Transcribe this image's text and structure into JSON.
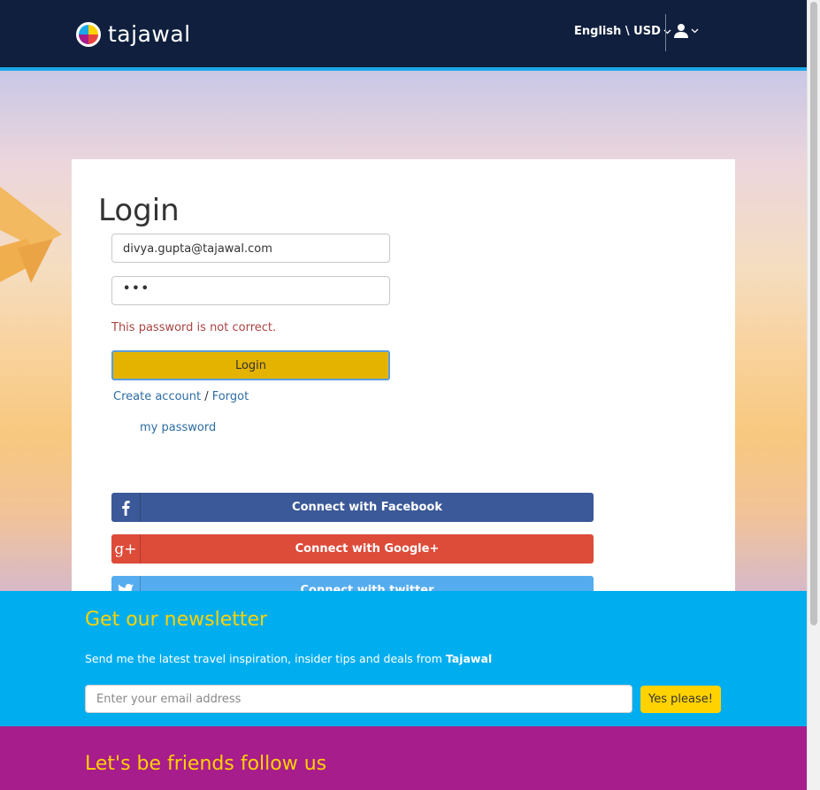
{
  "header": {
    "brand": "tajawal",
    "language_currency": "English \\ USD",
    "colors": {
      "bar": "#0f1f3d",
      "accent": "#1aa8e8"
    }
  },
  "login": {
    "title": "Login",
    "email_value": "divya.gupta@tajawal.com",
    "password_value": "•••",
    "error": "This password is not correct.",
    "submit_label": "Login",
    "create_account": "Create account",
    "separator": "/",
    "forgot_line1": "Forgot",
    "forgot_line2": "my password"
  },
  "social_login": [
    {
      "label": "Connect with Facebook",
      "icon": "facebook-icon",
      "color": "#3b5998"
    },
    {
      "label": "Connect with Google+",
      "icon": "google-plus-icon",
      "color": "#dd4b39"
    },
    {
      "label": "Connect with twitter",
      "icon": "twitter-icon",
      "color": "#55acee"
    }
  ],
  "newsletter": {
    "title": "Get our newsletter",
    "text_prefix": "Send me the latest travel inspiration, insider tips and deals from",
    "text_brand": "Tajawal",
    "placeholder": "Enter your email address",
    "button": "Yes please!"
  },
  "follow": {
    "title": "Let's be friends follow us"
  }
}
